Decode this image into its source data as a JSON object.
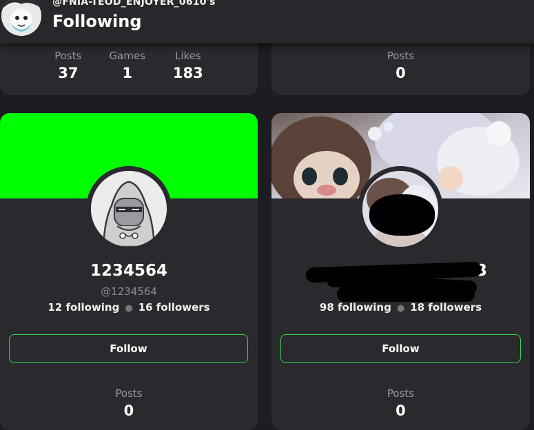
{
  "header": {
    "handle": "@FNIA-TEOD_ENJOYER_0610's",
    "title": "Following"
  },
  "top_cards": [
    {
      "stats": [
        {
          "label": "Posts",
          "value": "37"
        },
        {
          "label": "Games",
          "value": "1"
        },
        {
          "label": "Likes",
          "value": "183"
        }
      ]
    },
    {
      "stats": [
        {
          "label": "Posts",
          "value": "0"
        }
      ]
    }
  ],
  "users": [
    {
      "display_name": "1234564",
      "username": "@1234564",
      "following": "12 following",
      "followers": "16 followers",
      "follow_label": "Follow",
      "banner_color": "#00ff00",
      "posts_label": "Posts",
      "posts_value": "0"
    },
    {
      "display_name": "3",
      "username": "",
      "following": "98 following",
      "followers": "18 followers",
      "follow_label": "Follow",
      "posts_label": "Posts",
      "posts_value": "0"
    }
  ],
  "colors": {
    "accent_green": "#34d64a",
    "background": "#1d1c20",
    "card": "#2a292d"
  }
}
